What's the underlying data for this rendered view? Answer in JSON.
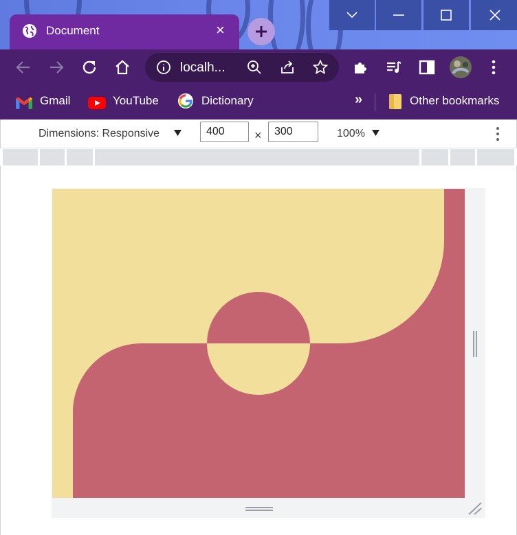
{
  "window": {
    "tab_title": "Document",
    "tab_close_glyph": "×",
    "new_tab_glyph": "+",
    "controls": [
      "chevron-down-icon",
      "minimize-icon",
      "maximize-icon",
      "close-icon"
    ]
  },
  "toolbar": {
    "url_text": "localh...",
    "icons": [
      "back-arrow-icon",
      "forward-arrow-icon",
      "reload-icon",
      "home-icon",
      "info-icon",
      "zoom-icon",
      "share-icon",
      "star-icon",
      "extensions-puzzle-icon",
      "media-queue-icon",
      "side-panel-icon",
      "profile-avatar",
      "menu-kebab-icon"
    ]
  },
  "bookmarks": {
    "items": [
      {
        "label": "Gmail",
        "icon": "gmail-icon"
      },
      {
        "label": "YouTube",
        "icon": "youtube-icon"
      },
      {
        "label": "Dictionary",
        "icon": "google-icon"
      }
    ],
    "overflow_glyph": "»",
    "other_label": "Other bookmarks"
  },
  "devtools": {
    "dimensions_label": "Dimensions: Responsive",
    "width_value": "400",
    "times_glyph": "×",
    "height_value": "300",
    "zoom_label": "100%"
  },
  "colors": {
    "page_cream": "#f2df9c",
    "page_rose": "#c46470",
    "tab_purple": "#6f2aa1",
    "toolbar_purple": "#4a1f6e"
  }
}
